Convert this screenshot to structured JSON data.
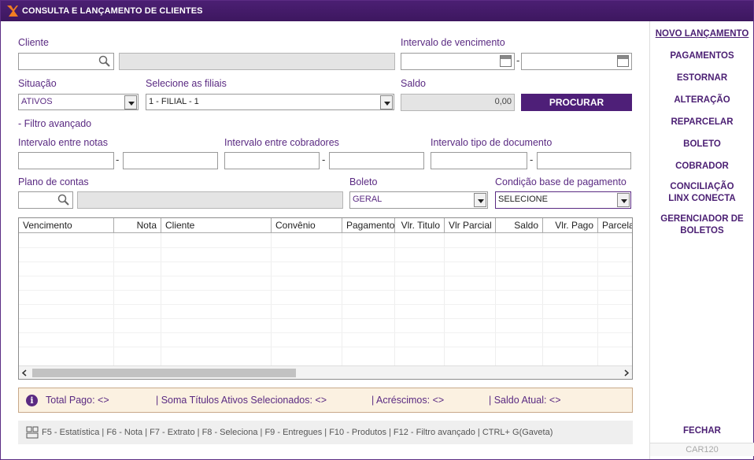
{
  "window": {
    "title": "CONSULTA E LANÇAMENTO DE CLIENTES"
  },
  "form": {
    "cliente_label": "Cliente",
    "cliente_value": "",
    "cliente_name": "",
    "vencimento_label": "Intervalo de vencimento",
    "vencimento_from": "",
    "vencimento_to": "",
    "situacao_label": "Situação",
    "situacao_value": "ATIVOS",
    "filiais_label": "Selecione as filiais",
    "filiais_value": "1 - FILIAL - 1",
    "saldo_label": "Saldo",
    "saldo_value": "0,00",
    "procurar": "PROCURAR",
    "filtro_avancado": "- Filtro avançado",
    "notas_label": "Intervalo entre notas",
    "cobradores_label": "Intervalo entre cobradores",
    "tipo_doc_label": "Intervalo tipo de documento",
    "plano_label": "Plano de contas",
    "boleto_label": "Boleto",
    "boleto_value": "GERAL",
    "condicao_label": "Condição base de pagamento",
    "condicao_value": "SELECIONE",
    "dash": "-"
  },
  "grid": {
    "columns": [
      "Vencimento",
      "Nota",
      "Cliente",
      "Convênio",
      "Pagamento",
      "Vlr. Titulo",
      "Vlr Parcial",
      "Saldo",
      "Vlr. Pago",
      "Parcela"
    ],
    "rows": []
  },
  "info": {
    "total_pago": "Total Pago: <>",
    "soma": "| Soma Títulos Ativos Selecionados: <>",
    "acrescimos": "| Acréscimos: <>",
    "saldo_atual": "| Saldo Atual: <>"
  },
  "footer": {
    "shortcuts": "F5 - Estatística  |  F6 - Nota  |  F7 - Extrato  |  F8 - Seleciona  |  F9 - Entregues  |  F10 - Produtos  |  F12 - Filtro avançado  |  CTRL+ G(Gaveta)"
  },
  "sidebar": {
    "novo_lancamento": "NOVO LANÇAMENTO",
    "pagamentos": "PAGAMENTOS",
    "estornar": "ESTORNAR",
    "alteracao": "ALTERAÇÃO",
    "reparcelar": "REPARCELAR",
    "boleto": "BOLETO",
    "cobrador": "COBRADOR",
    "conciliacao": "CONCILIAÇÃO LINX CONECTA",
    "gerenciador": "GERENCIADOR DE BOLETOS",
    "fechar": "FECHAR",
    "code": "CAR120"
  },
  "colors": {
    "accent": "#4e1f78",
    "label": "#5a2a82",
    "info_bg": "#fbf1e1"
  }
}
